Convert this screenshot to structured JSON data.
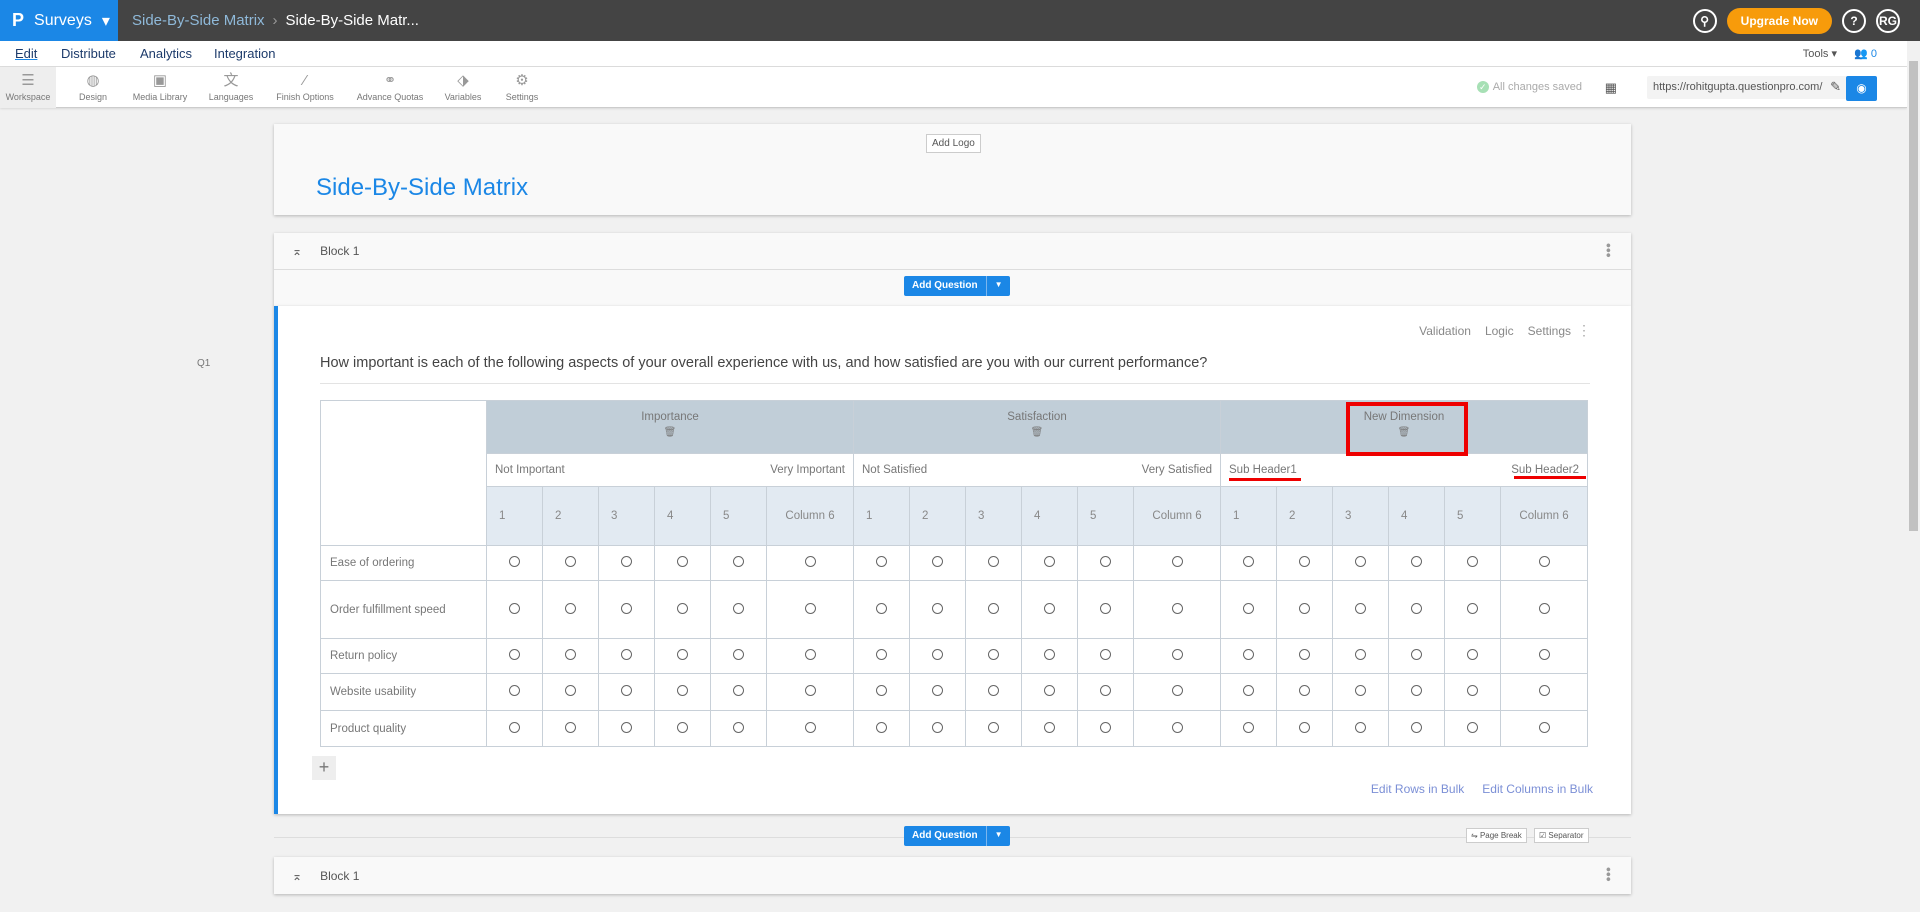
{
  "topbar": {
    "brand": "Surveys",
    "crumb_parent": "Side-By-Side Matrix",
    "crumb_current": "Side-By-Side Matr...",
    "upgrade": "Upgrade Now",
    "help": "?",
    "avatar": "RG"
  },
  "menu": {
    "items": [
      "Edit",
      "Distribute",
      "Analytics",
      "Integration"
    ],
    "tools": "Tools",
    "user_count": "0"
  },
  "toolbar": {
    "items": [
      "Workspace",
      "Design",
      "Media Library",
      "Languages",
      "Finish Options",
      "Advance Quotas",
      "Variables",
      "Settings"
    ],
    "saved": "All changes saved",
    "url": "https://rohitgupta.questionpro.com/"
  },
  "header": {
    "add_logo": "Add Logo",
    "title": "Side-By-Side Matrix"
  },
  "block": {
    "name": "Block 1",
    "add_question": "Add Question"
  },
  "question": {
    "number": "Q1",
    "links": [
      "Validation",
      "Logic",
      "Settings"
    ],
    "text": "How important is each of the following aspects of your overall experience with us, and how satisfied are you with our current performance?",
    "dimensions": [
      {
        "name": "Importance",
        "left": "Not Important",
        "right": "Very Important"
      },
      {
        "name": "Satisfaction",
        "left": "Not Satisfied",
        "right": "Very Satisfied"
      },
      {
        "name": "New Dimension",
        "left": "Sub Header1",
        "right": "Sub Header2"
      }
    ],
    "columns": [
      "1",
      "2",
      "3",
      "4",
      "5",
      "Column 6"
    ],
    "rows": [
      "Ease of ordering",
      "Order fulfillment speed",
      "Return policy",
      "Website usability",
      "Product quality"
    ],
    "edit_rows": "Edit Rows in Bulk",
    "edit_columns": "Edit Columns in Bulk"
  },
  "footer": {
    "page_break": "Page Break",
    "separator": "Separator",
    "add_question": "Add Question",
    "block": "Block 1"
  },
  "colors": {
    "accent": "#1b87e6",
    "upgrade": "#f79b0b",
    "highlight": "#e00000"
  }
}
